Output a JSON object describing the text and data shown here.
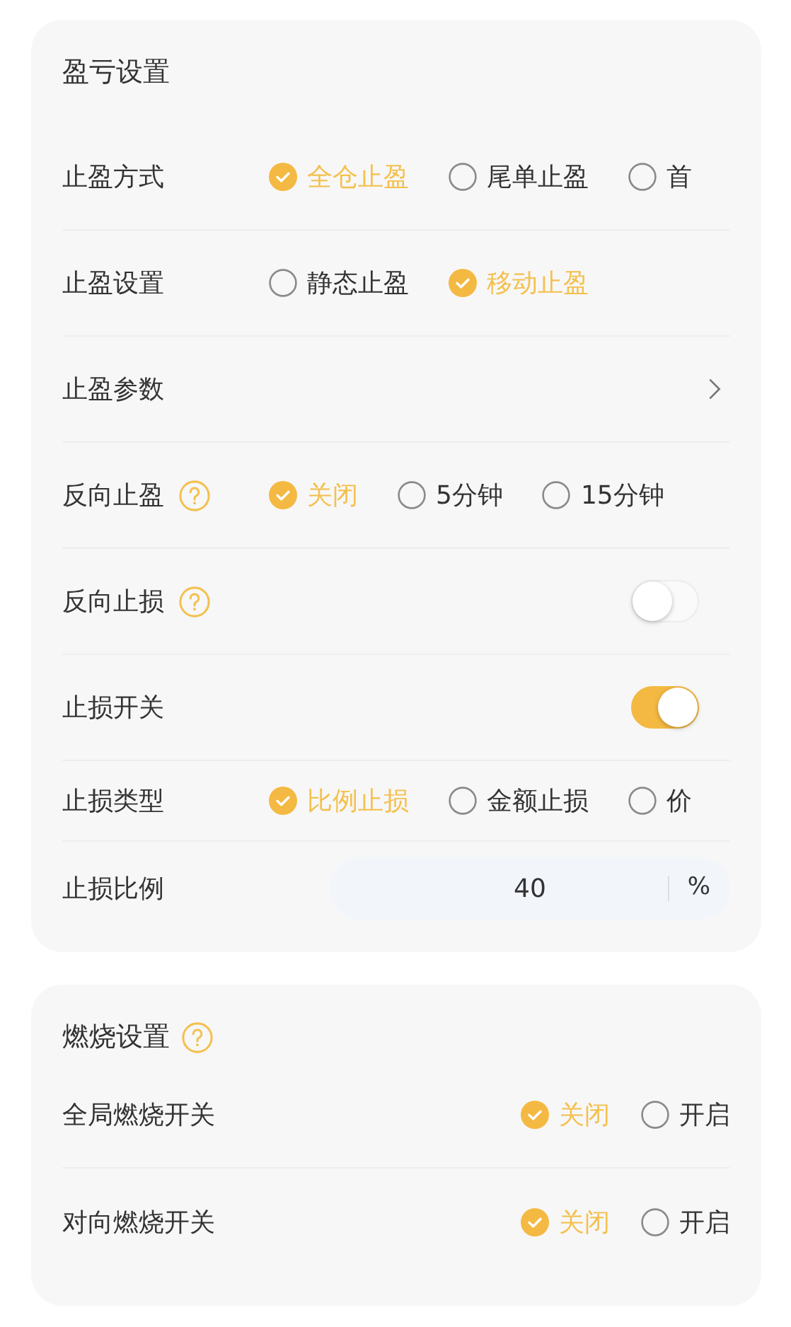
{
  "sections": [
    {
      "title": "盈亏设置",
      "help": false,
      "rows": [
        {
          "kind": "radio",
          "label": "止盈方式",
          "help": false,
          "options": [
            {
              "label": "全仓止盈",
              "selected": true
            },
            {
              "label": "尾单止盈",
              "selected": false
            },
            {
              "label": "首",
              "selected": false
            }
          ]
        },
        {
          "kind": "radio",
          "label": "止盈设置",
          "help": false,
          "options": [
            {
              "label": "静态止盈",
              "selected": false
            },
            {
              "label": "移动止盈",
              "selected": true
            }
          ]
        },
        {
          "kind": "link",
          "label": "止盈参数",
          "help": false
        },
        {
          "kind": "radio",
          "label": "反向止盈",
          "help": true,
          "options": [
            {
              "label": "关闭",
              "selected": true
            },
            {
              "label": "5分钟",
              "selected": false
            },
            {
              "label": "15分钟",
              "selected": false
            }
          ]
        },
        {
          "kind": "switch",
          "label": "反向止损",
          "help": true,
          "on": false
        },
        {
          "kind": "switch",
          "label": "止损开关",
          "help": false,
          "on": true
        },
        {
          "kind": "radio",
          "label": "止损类型",
          "help": false,
          "options": [
            {
              "label": "比例止损",
              "selected": true
            },
            {
              "label": "金额止损",
              "selected": false
            },
            {
              "label": "价",
              "selected": false
            }
          ]
        },
        {
          "kind": "input",
          "label": "止损比例",
          "help": false,
          "value": "40",
          "unit": "%"
        }
      ]
    },
    {
      "title": "燃烧设置",
      "help": true,
      "rows": [
        {
          "kind": "radio",
          "label": "全局燃烧开关",
          "help": false,
          "options": [
            {
              "label": "关闭",
              "selected": true
            },
            {
              "label": "开启",
              "selected": false
            }
          ]
        },
        {
          "kind": "radio",
          "label": "对向燃烧开关",
          "help": false,
          "options": [
            {
              "label": "关闭",
              "selected": true
            },
            {
              "label": "开启",
              "selected": false
            }
          ]
        }
      ]
    }
  ]
}
